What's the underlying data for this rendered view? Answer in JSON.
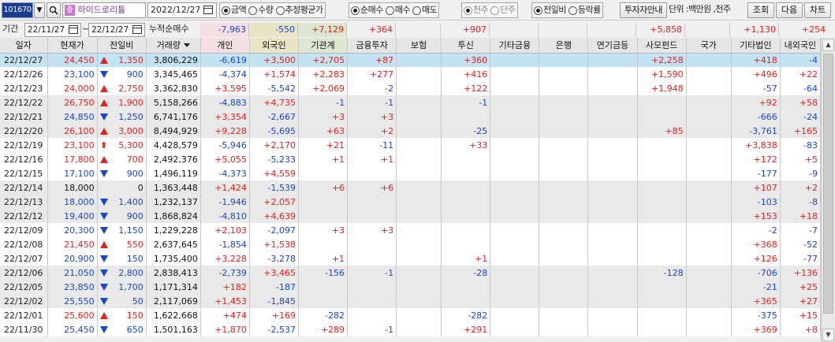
{
  "toolbar": {
    "code": "101670",
    "company": "하이드로리튬",
    "date": "2022/12/27",
    "unit_options": [
      "금액",
      "수량",
      "추정평균가"
    ],
    "trade_options": [
      "순매수",
      "매수",
      "매도"
    ],
    "share_options": [
      "천주",
      "단주"
    ],
    "compare_options": [
      "전일비",
      "등락률"
    ],
    "investor_guide": "투자자안내",
    "unit_label": "단위 :백만원 ,천주",
    "query": "조회",
    "next": "다음",
    "chart": "차트"
  },
  "period": {
    "label": "기간",
    "from": "22/11/27",
    "to": "22/12/27",
    "cumulative_label": "누적순매수",
    "sums": [
      "-7,963",
      "-550",
      "+7,129",
      "+364",
      "",
      "+907",
      "",
      "",
      "",
      "+5,858",
      "",
      "+1,130",
      "+254"
    ]
  },
  "columns": [
    "일자",
    "현재가",
    "전일비",
    "거래량",
    "개인",
    "외국인",
    "기관계",
    "금융투자",
    "보험",
    "투신",
    "기타금융",
    "은행",
    "연기금등",
    "사모펀드",
    "국가",
    "기타법인",
    "내외국인"
  ],
  "rows": [
    {
      "d": "22/12/27",
      "p": "24,450",
      "dir": "up",
      "c": "1,350",
      "v": "3,806,229",
      "ind": "-6,619",
      "frg": "+3,500",
      "inst": "+2,705",
      "fin": "+87",
      "ins": "",
      "inv": "+360",
      "oth": "",
      "bank": "",
      "pen": "",
      "pef": "+2,258",
      "gov": "",
      "corp": "+418",
      "nat": "-4",
      "sel": true
    },
    {
      "d": "22/12/26",
      "p": "23,100",
      "dir": "down",
      "c": "900",
      "v": "3,345,465",
      "ind": "-4,374",
      "frg": "+1,574",
      "inst": "+2,283",
      "fin": "+277",
      "ins": "",
      "inv": "+416",
      "oth": "",
      "bank": "",
      "pen": "",
      "pef": "+1,590",
      "gov": "",
      "corp": "+496",
      "nat": "+22"
    },
    {
      "d": "22/12/23",
      "p": "24,000",
      "dir": "up",
      "c": "2,750",
      "v": "3,362,830",
      "ind": "+3,595",
      "frg": "-5,542",
      "inst": "+2,069",
      "fin": "-2",
      "ins": "",
      "inv": "+122",
      "oth": "",
      "bank": "",
      "pen": "",
      "pef": "+1,948",
      "gov": "",
      "corp": "-57",
      "nat": "-64"
    },
    {
      "d": "22/12/22",
      "p": "26,750",
      "dir": "up",
      "c": "1,900",
      "v": "5,158,266",
      "ind": "-4,883",
      "frg": "+4,735",
      "inst": "-1",
      "fin": "-1",
      "ins": "",
      "inv": "-1",
      "oth": "",
      "bank": "",
      "pen": "",
      "pef": "",
      "gov": "",
      "corp": "+92",
      "nat": "+58",
      "gray": true
    },
    {
      "d": "22/12/21",
      "p": "24,850",
      "dir": "down",
      "c": "1,250",
      "v": "6,741,176",
      "ind": "+3,354",
      "frg": "-2,667",
      "inst": "+3",
      "fin": "+3",
      "ins": "",
      "inv": "",
      "oth": "",
      "bank": "",
      "pen": "",
      "pef": "",
      "gov": "",
      "corp": "-666",
      "nat": "-24",
      "gray": true
    },
    {
      "d": "22/12/20",
      "p": "26,100",
      "dir": "up",
      "c": "3,000",
      "v": "8,494,929",
      "ind": "+9,228",
      "frg": "-5,695",
      "inst": "+63",
      "fin": "+2",
      "ins": "",
      "inv": "-25",
      "oth": "",
      "bank": "",
      "pen": "",
      "pef": "+85",
      "gov": "",
      "corp": "-3,761",
      "nat": "+165",
      "gray": true
    },
    {
      "d": "22/12/19",
      "p": "23,100",
      "dir": "upper",
      "c": "5,300",
      "v": "4,428,579",
      "ind": "-5,946",
      "frg": "+2,170",
      "inst": "+21",
      "fin": "-11",
      "ins": "",
      "inv": "+33",
      "oth": "",
      "bank": "",
      "pen": "",
      "pef": "",
      "gov": "",
      "corp": "+3,838",
      "nat": "-83"
    },
    {
      "d": "22/12/16",
      "p": "17,800",
      "dir": "up",
      "c": "700",
      "v": "2,492,376",
      "ind": "+5,055",
      "frg": "-5,233",
      "inst": "+1",
      "fin": "+1",
      "ins": "",
      "inv": "",
      "oth": "",
      "bank": "",
      "pen": "",
      "pef": "",
      "gov": "",
      "corp": "+172",
      "nat": "+5"
    },
    {
      "d": "22/12/15",
      "p": "17,100",
      "dir": "down",
      "c": "900",
      "v": "1,496,119",
      "ind": "-4,373",
      "frg": "+4,559",
      "inst": "",
      "fin": "",
      "ins": "",
      "inv": "",
      "oth": "",
      "bank": "",
      "pen": "",
      "pef": "",
      "gov": "",
      "corp": "-177",
      "nat": "-9"
    },
    {
      "d": "22/12/14",
      "p": "18,000",
      "dir": "none",
      "c": "0",
      "v": "1,363,448",
      "ind": "+1,424",
      "frg": "-1,539",
      "inst": "+6",
      "fin": "+6",
      "ins": "",
      "inv": "",
      "oth": "",
      "bank": "",
      "pen": "",
      "pef": "",
      "gov": "",
      "corp": "+107",
      "nat": "+2",
      "gray": true
    },
    {
      "d": "22/12/13",
      "p": "18,000",
      "dir": "down",
      "c": "1,400",
      "v": "1,232,137",
      "ind": "-1,946",
      "frg": "+2,057",
      "inst": "",
      "fin": "",
      "ins": "",
      "inv": "",
      "oth": "",
      "bank": "",
      "pen": "",
      "pef": "",
      "gov": "",
      "corp": "-103",
      "nat": "-8",
      "gray": true
    },
    {
      "d": "22/12/12",
      "p": "19,400",
      "dir": "down",
      "c": "900",
      "v": "1,868,824",
      "ind": "-4,810",
      "frg": "+4,639",
      "inst": "",
      "fin": "",
      "ins": "",
      "inv": "",
      "oth": "",
      "bank": "",
      "pen": "",
      "pef": "",
      "gov": "",
      "corp": "+153",
      "nat": "+18",
      "gray": true
    },
    {
      "d": "22/12/09",
      "p": "20,300",
      "dir": "down",
      "c": "1,150",
      "v": "1,229,228",
      "ind": "+2,103",
      "frg": "-2,097",
      "inst": "+3",
      "fin": "+3",
      "ins": "",
      "inv": "",
      "oth": "",
      "bank": "",
      "pen": "",
      "pef": "",
      "gov": "",
      "corp": "-2",
      "nat": "-7"
    },
    {
      "d": "22/12/08",
      "p": "21,450",
      "dir": "up",
      "c": "550",
      "v": "2,637,645",
      "ind": "-1,854",
      "frg": "+1,538",
      "inst": "",
      "fin": "",
      "ins": "",
      "inv": "",
      "oth": "",
      "bank": "",
      "pen": "",
      "pef": "",
      "gov": "",
      "corp": "+368",
      "nat": "-52"
    },
    {
      "d": "22/12/07",
      "p": "20,900",
      "dir": "down",
      "c": "150",
      "v": "1,735,400",
      "ind": "+3,228",
      "frg": "-3,278",
      "inst": "+1",
      "fin": "",
      "ins": "",
      "inv": "+1",
      "oth": "",
      "bank": "",
      "pen": "",
      "pef": "",
      "gov": "",
      "corp": "+126",
      "nat": "-77"
    },
    {
      "d": "22/12/06",
      "p": "21,050",
      "dir": "down",
      "c": "2,800",
      "v": "2,838,413",
      "ind": "-2,739",
      "frg": "+3,465",
      "inst": "-156",
      "fin": "-1",
      "ins": "",
      "inv": "-28",
      "oth": "",
      "bank": "",
      "pen": "",
      "pef": "-128",
      "gov": "",
      "corp": "-706",
      "nat": "+136",
      "gray": true
    },
    {
      "d": "22/12/05",
      "p": "23,850",
      "dir": "down",
      "c": "1,700",
      "v": "1,171,314",
      "ind": "+182",
      "frg": "-187",
      "inst": "",
      "fin": "",
      "ins": "",
      "inv": "",
      "oth": "",
      "bank": "",
      "pen": "",
      "pef": "",
      "gov": "",
      "corp": "-21",
      "nat": "+25",
      "gray": true
    },
    {
      "d": "22/12/02",
      "p": "25,550",
      "dir": "down",
      "c": "50",
      "v": "2,117,069",
      "ind": "+1,453",
      "frg": "-1,845",
      "inst": "",
      "fin": "",
      "ins": "",
      "inv": "",
      "oth": "",
      "bank": "",
      "pen": "",
      "pef": "",
      "gov": "",
      "corp": "+365",
      "nat": "+27",
      "gray": true
    },
    {
      "d": "22/12/01",
      "p": "25,600",
      "dir": "up",
      "c": "150",
      "v": "1,622,668",
      "ind": "+474",
      "frg": "+169",
      "inst": "-282",
      "fin": "",
      "ins": "",
      "inv": "-282",
      "oth": "",
      "bank": "",
      "pen": "",
      "pef": "",
      "gov": "",
      "corp": "-375",
      "nat": "+15"
    },
    {
      "d": "22/11/30",
      "p": "25,450",
      "dir": "down",
      "c": "650",
      "v": "1,501,163",
      "ind": "+1,870",
      "frg": "-2,537",
      "inst": "+289",
      "fin": "-1",
      "ins": "",
      "inv": "+291",
      "oth": "",
      "bank": "",
      "pen": "",
      "pef": "",
      "gov": "",
      "corp": "+369",
      "nat": "+8"
    }
  ],
  "colors": {
    "up": "#e0231e",
    "down": "#1a46c8",
    "selected": "#c3e3f3"
  }
}
